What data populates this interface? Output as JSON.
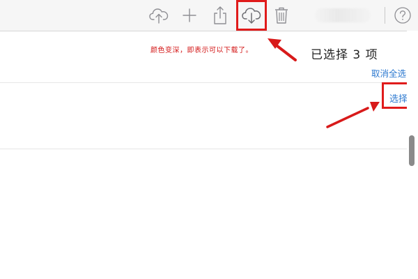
{
  "toolbar": {
    "icons": [
      "cloud-upload-icon",
      "plus-icon",
      "share-icon",
      "cloud-download-icon",
      "trash-icon",
      "help-icon"
    ]
  },
  "selection": {
    "count_text": "已选择 3 项",
    "deselect_all": "取消全选",
    "select": "选择"
  },
  "annotation": {
    "text": "颜色变深，即表示可以下载了。"
  },
  "colors": {
    "accent": "#2e7ad0",
    "annotation_red": "#e01b1b",
    "toolbar_icon": "#8e8e93"
  }
}
